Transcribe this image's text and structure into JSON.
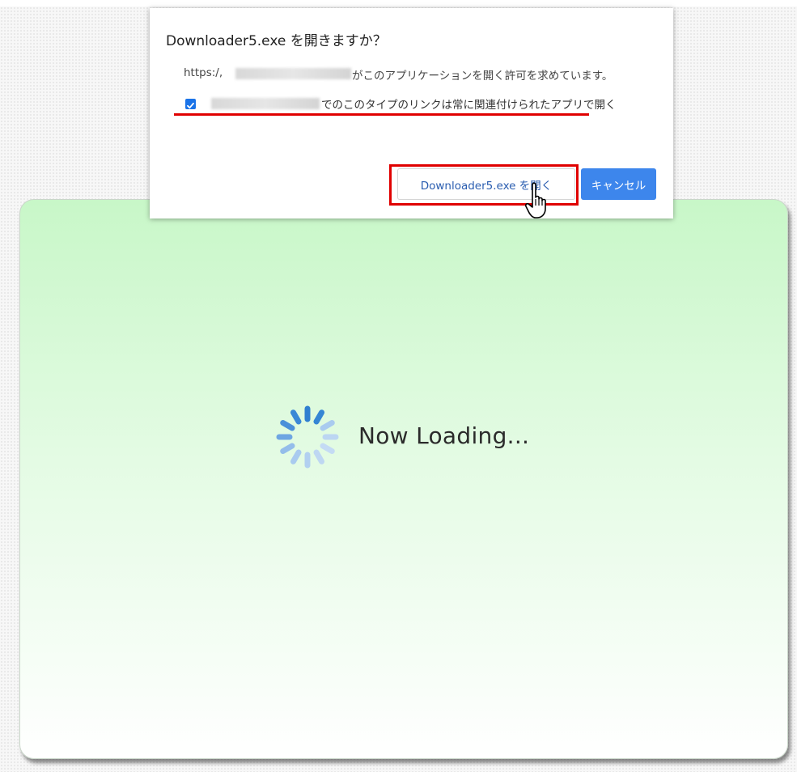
{
  "dialog": {
    "title": "Downloader5.exe を開きますか？",
    "message_prefix": "https:/,",
    "message_suffix": "がこのアプリケーションを開く許可を求めています。",
    "checkbox_checked": true,
    "checkbox_label": "でのこのタイプのリンクは常に関連付けられたアプリで開く",
    "open_button_label": "Downloader5.exe を開く",
    "cancel_button_label": "キャンセル"
  },
  "loading": {
    "text": "Now Loading..."
  },
  "colors": {
    "accent_blue": "#3d86ec",
    "highlight_red": "#e00000",
    "panel_green": "#c8f7c8",
    "spinner_blue": "#4a90d9"
  },
  "icons": {
    "spinner": "loading-spinner-icon",
    "cursor": "hand-pointer-cursor-icon",
    "checkbox": "checkmark-icon"
  }
}
